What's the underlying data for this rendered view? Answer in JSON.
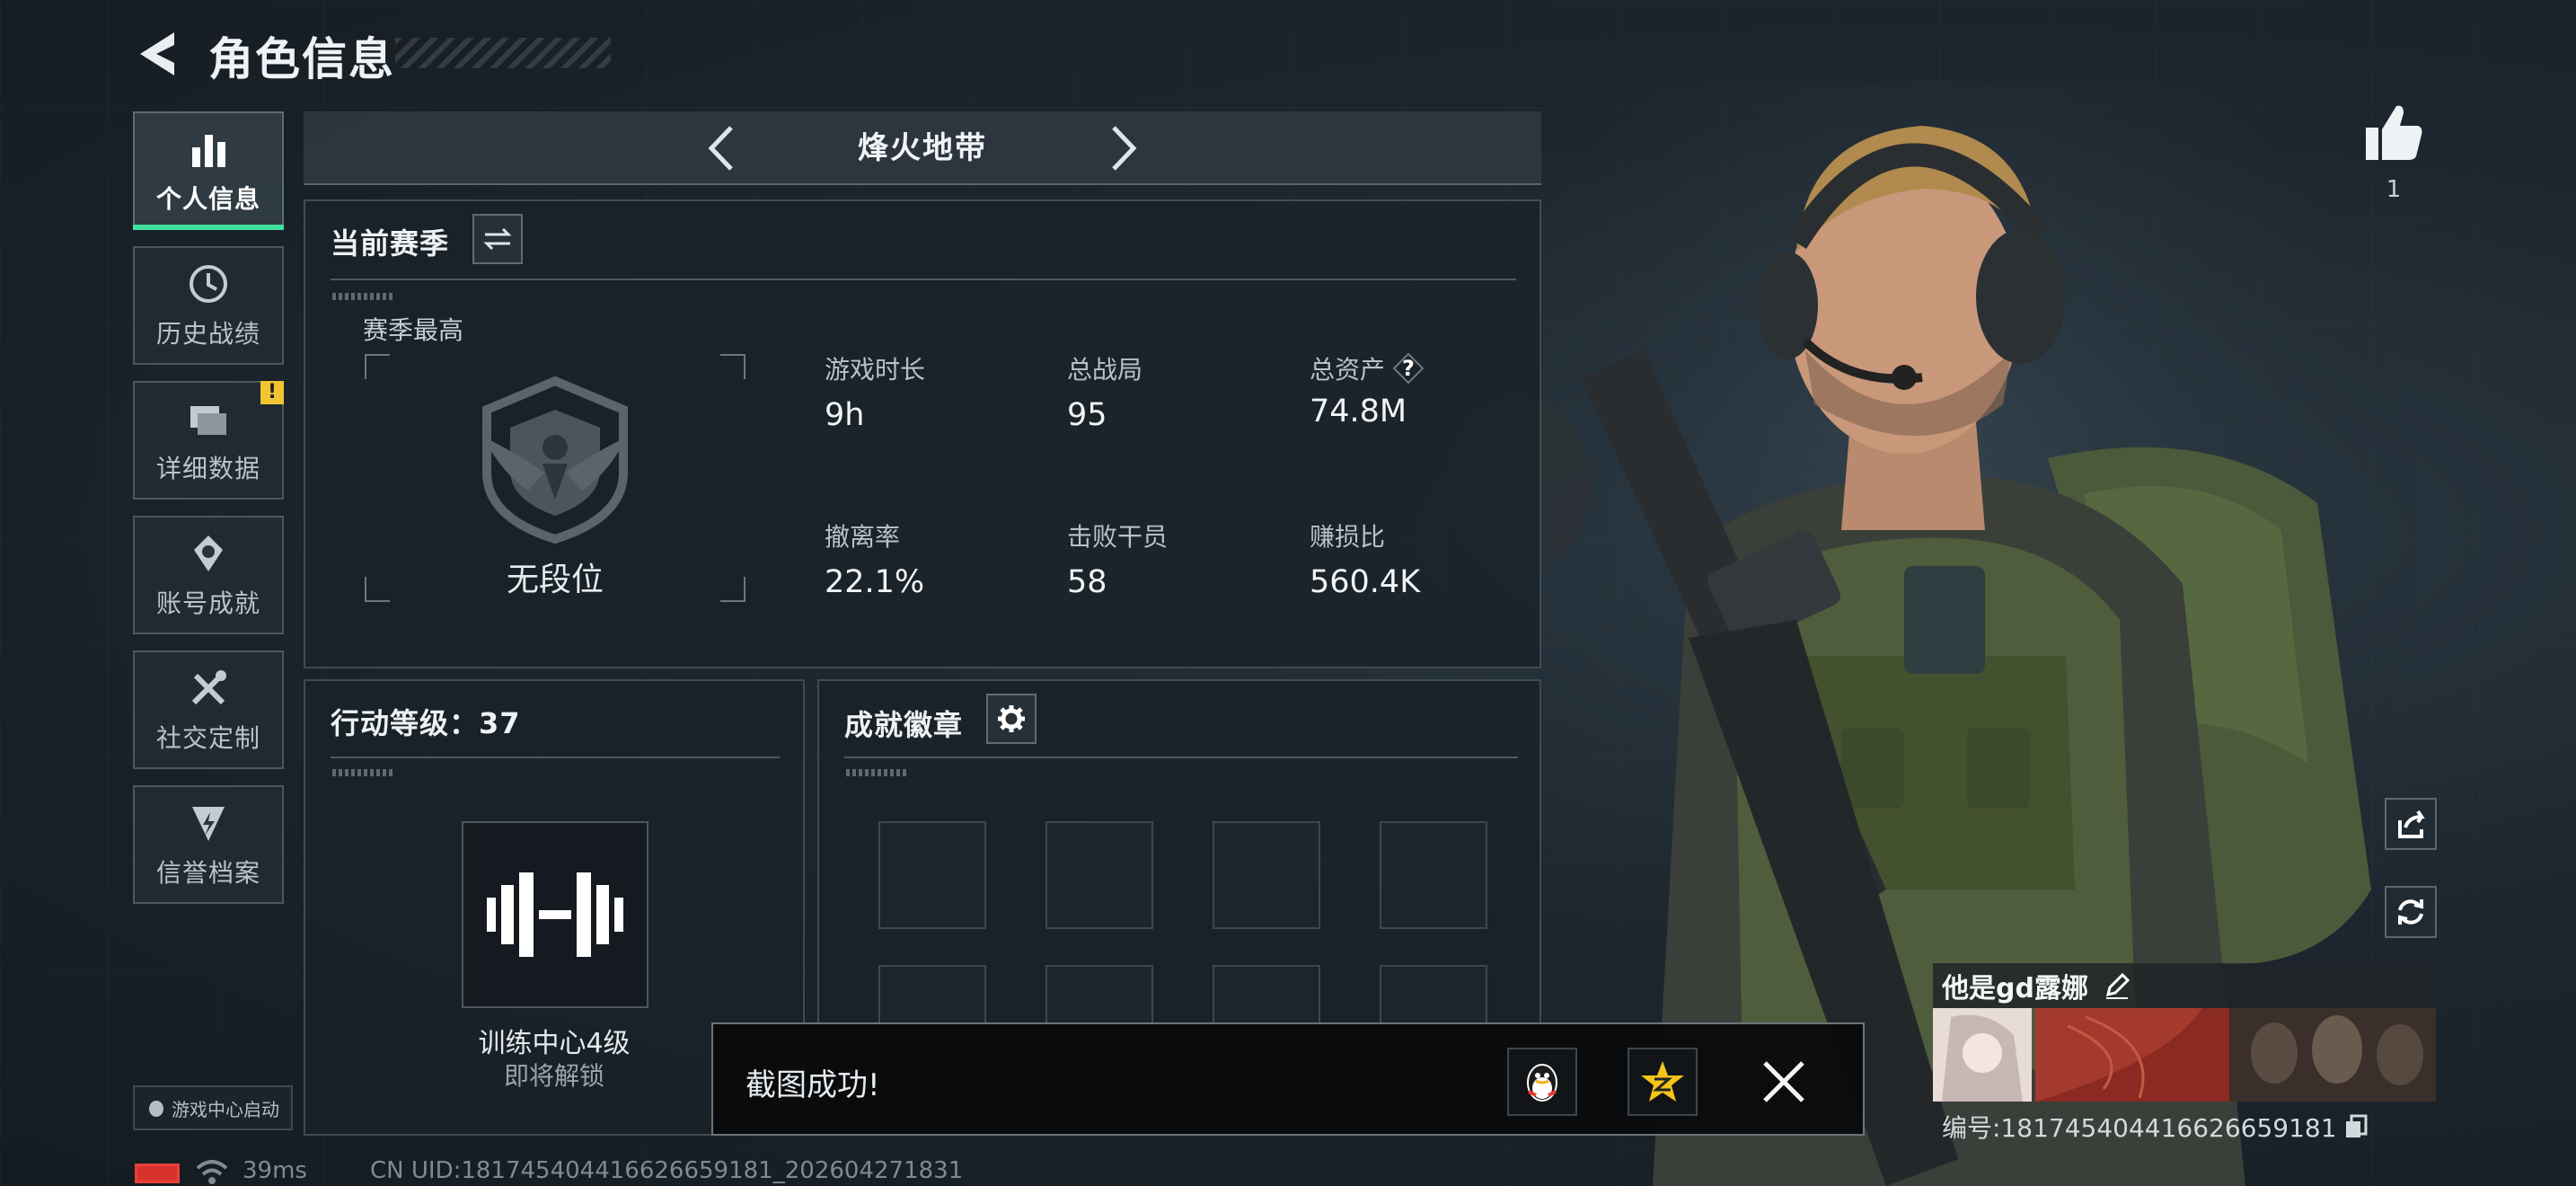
{
  "header": {
    "title": "角色信息",
    "back_icon": "back-arrow-icon"
  },
  "sidebar": {
    "items": [
      {
        "label": "个人信息",
        "icon": "bar-chart-icon",
        "active": true
      },
      {
        "label": "历史战绩",
        "icon": "history-clock-icon",
        "active": false
      },
      {
        "label": "详细数据",
        "icon": "folder-icon",
        "active": false,
        "badge": "!"
      },
      {
        "label": "账号成就",
        "icon": "medal-icon",
        "active": false
      },
      {
        "label": "社交定制",
        "icon": "tools-icon",
        "active": false
      },
      {
        "label": "信誉档案",
        "icon": "shield-lightning-icon",
        "active": false
      }
    ],
    "launch_chip": "游戏中心启动"
  },
  "mode": {
    "title": "烽火地带"
  },
  "season": {
    "title": "当前赛季",
    "best_label": "赛季最高",
    "rank": "无段位",
    "stats": [
      {
        "label": "游戏时长",
        "value": "9h"
      },
      {
        "label": "总战局",
        "value": "95"
      },
      {
        "label": "总资产",
        "value": "74.8M",
        "help": "?"
      },
      {
        "label": "撤离率",
        "value": "22.1%"
      },
      {
        "label": "击败干员",
        "value": "58"
      },
      {
        "label": "赚损比",
        "value": "560.4K"
      }
    ]
  },
  "level": {
    "title": "行动等级：37",
    "training_name": "训练中心4级",
    "training_status": "即将解锁"
  },
  "badges": {
    "title": "成就徽章",
    "slot_count": 8
  },
  "toast": {
    "message": "截图成功!"
  },
  "status_bar": {
    "ping": "39ms",
    "uid_line": "CN UID:181745404416626659181_202604271831"
  },
  "profile": {
    "likes": "1",
    "player_name": "他是gd露娜",
    "uid_line": "编号:181745404416626659181"
  },
  "colors": {
    "accent": "#3fe0a0",
    "warning": "#f0c531",
    "battery": "#d8322c"
  }
}
